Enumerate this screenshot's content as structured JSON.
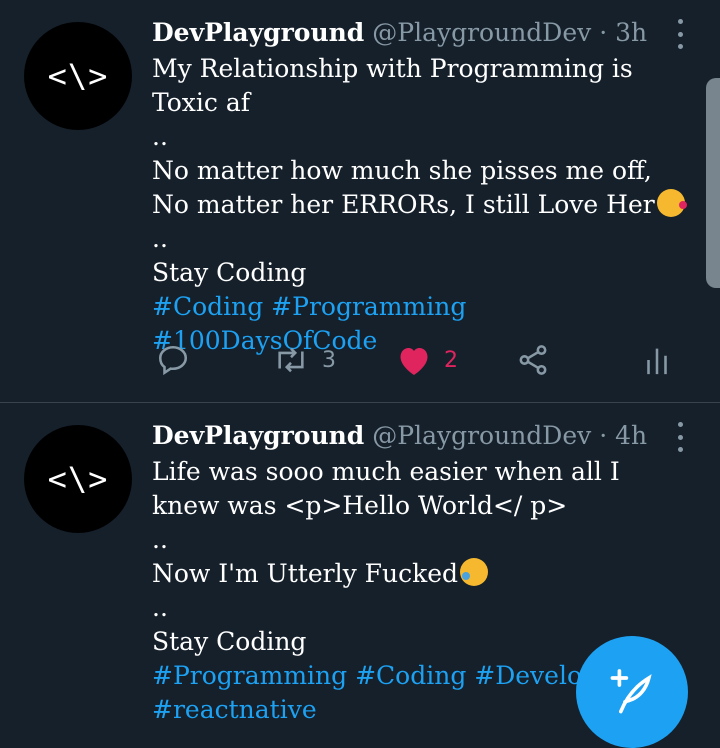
{
  "tweets": [
    {
      "avatar_text": "<\\>",
      "name": "DevPlayground",
      "handle": "@PlaygroundDev",
      "separator": "·",
      "time": "3h",
      "lines": [
        "My Relationship with Programming is Toxic af",
        "..",
        "No matter how much she pisses me off, No matter her ERRORs, I still Love Her",
        "..",
        "Stay Coding"
      ],
      "hashtags": "#Coding #Programming #100DaysOfCode",
      "retweets": "3",
      "likes": "2"
    },
    {
      "avatar_text": "<\\>",
      "name": "DevPlayground",
      "handle": "@PlaygroundDev",
      "separator": "·",
      "time": "4h",
      "lines": [
        "Life was sooo much easier when all I knew was <p>Hello World</ p>",
        "..",
        "Now I'm Utterly Fucked",
        "..",
        "Stay Coding"
      ],
      "hashtags": "#Programming #Coding #Developer #reactnative"
    }
  ],
  "colors": {
    "background": "#15202b",
    "accent": "#1da1f2",
    "like": "#e0245e",
    "muted": "#8899a6"
  },
  "icons": [
    "reply-icon",
    "retweet-icon",
    "heart-icon",
    "share-icon",
    "analytics-icon",
    "more-icon",
    "compose-feather-icon"
  ]
}
